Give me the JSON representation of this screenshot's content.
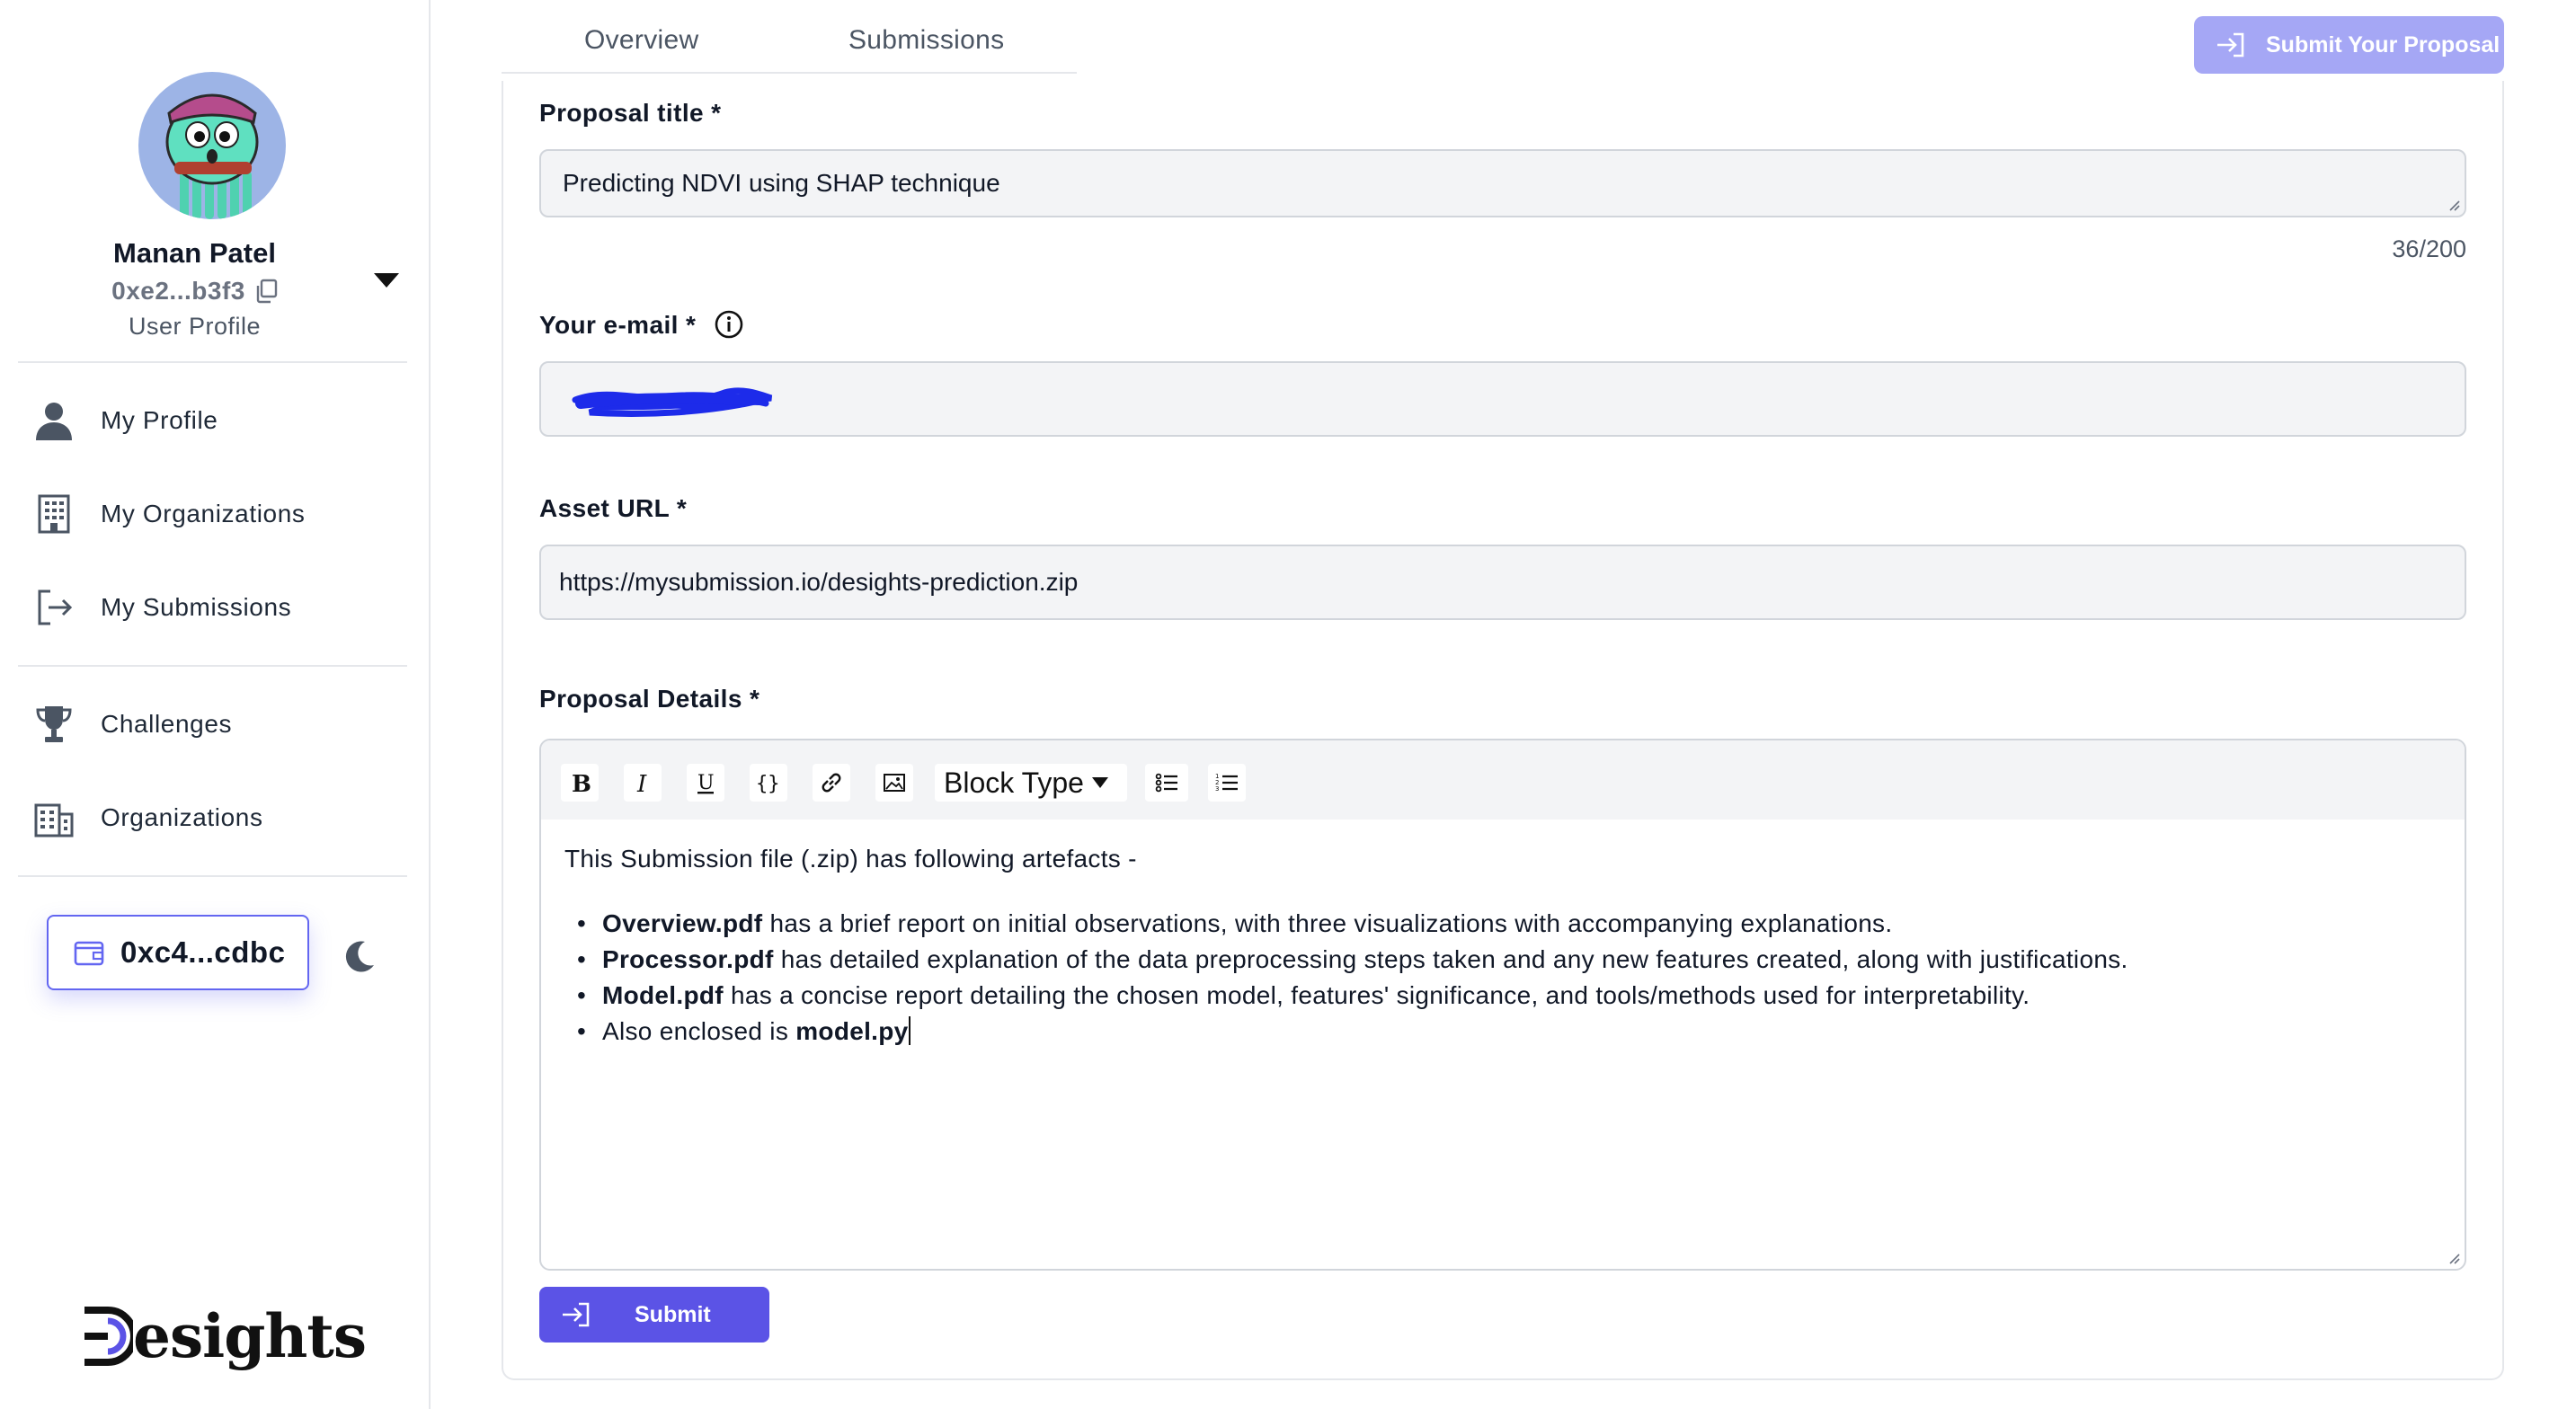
{
  "sidebar": {
    "user": {
      "name": "Manan Patel",
      "address": "0xe2...b3f3",
      "role": "User Profile"
    },
    "nav_primary": [
      {
        "label": "My Profile",
        "icon": "user-icon"
      },
      {
        "label": "My Organizations",
        "icon": "building-icon"
      },
      {
        "label": "My Submissions",
        "icon": "logout-icon"
      }
    ],
    "nav_secondary": [
      {
        "label": "Challenges",
        "icon": "trophy-icon"
      },
      {
        "label": "Organizations",
        "icon": "office-buildings-icon"
      }
    ],
    "wallet_address": "0xc4...cdbc",
    "logo_text": "esights"
  },
  "tabs": [
    {
      "label": "Overview"
    },
    {
      "label": "Submissions"
    }
  ],
  "header": {
    "submit_proposal_label": "Submit Your Proposal"
  },
  "form": {
    "title_label": "Proposal title *",
    "title_value": "Predicting NDVI using SHAP technique",
    "title_counter": "36/200",
    "email_label": "Your e-mail *",
    "asset_label": "Asset URL *",
    "asset_value": "https://mysubmission.io/desights-prediction.zip",
    "details_label": "Proposal Details *",
    "toolbar": {
      "block_type": "Block Type"
    },
    "details": {
      "intro": "This Submission file (.zip) has following artefacts -",
      "items": [
        {
          "bold": "Overview.pdf",
          "text": " has a brief report on initial observations, with three visualizations with accompanying explanations."
        },
        {
          "bold": "Processor.pdf",
          "text": " has detailed explanation of the data preprocessing steps taken and any new features created, along with justifications."
        },
        {
          "bold": "Model.pdf",
          "text": " has a concise report detailing the chosen model, features' significance, and tools/methods used for interpretability."
        },
        {
          "text": "Also enclosed is ",
          "bold": "model.py"
        }
      ]
    },
    "submit_label": "Submit"
  },
  "colors": {
    "accent": "#5b53e6",
    "accent_light": "#a5a7f5",
    "redaction": "#1d2bea"
  }
}
